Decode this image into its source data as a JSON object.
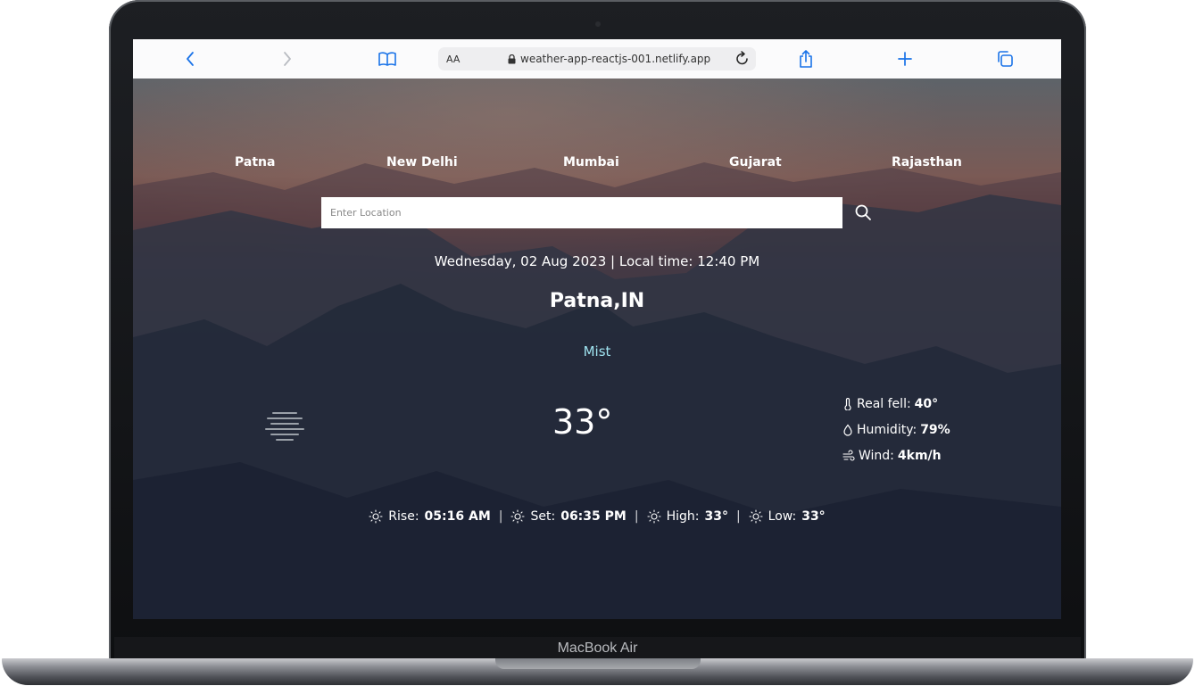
{
  "device": {
    "brand_label": "MacBook Air"
  },
  "browser": {
    "text_size_label": "AA",
    "url": "weather-app-reactjs-001.netlify.app",
    "icons": [
      "back-icon",
      "forward-icon",
      "bookmarks-icon",
      "lock-icon",
      "reload-icon",
      "share-icon",
      "new-tab-icon",
      "tabs-icon"
    ]
  },
  "app": {
    "cities": [
      "Patna",
      "New Delhi",
      "Mumbai",
      "Gujarat",
      "Rajasthan"
    ],
    "search": {
      "placeholder": "Enter Location"
    },
    "datetime": "Wednesday, 02 Aug 2023 | Local time: 12:40 PM",
    "location": "Patna,IN",
    "condition": "Mist",
    "condition_color": "#9fe3f0",
    "temperature": "33°",
    "details": {
      "real_feel_label": "Real fell:",
      "real_feel_value": "40°",
      "humidity_label": "Humidity:",
      "humidity_value": "79%",
      "wind_label": "Wind:",
      "wind_value": "4km/h"
    },
    "bottom": {
      "rise_label": "Rise:",
      "rise_value": "05:16 AM",
      "set_label": "Set:",
      "set_value": "06:35 PM",
      "high_label": "High:",
      "high_value": "33°",
      "low_label": "Low:",
      "low_value": "33°",
      "separator": "|"
    }
  }
}
